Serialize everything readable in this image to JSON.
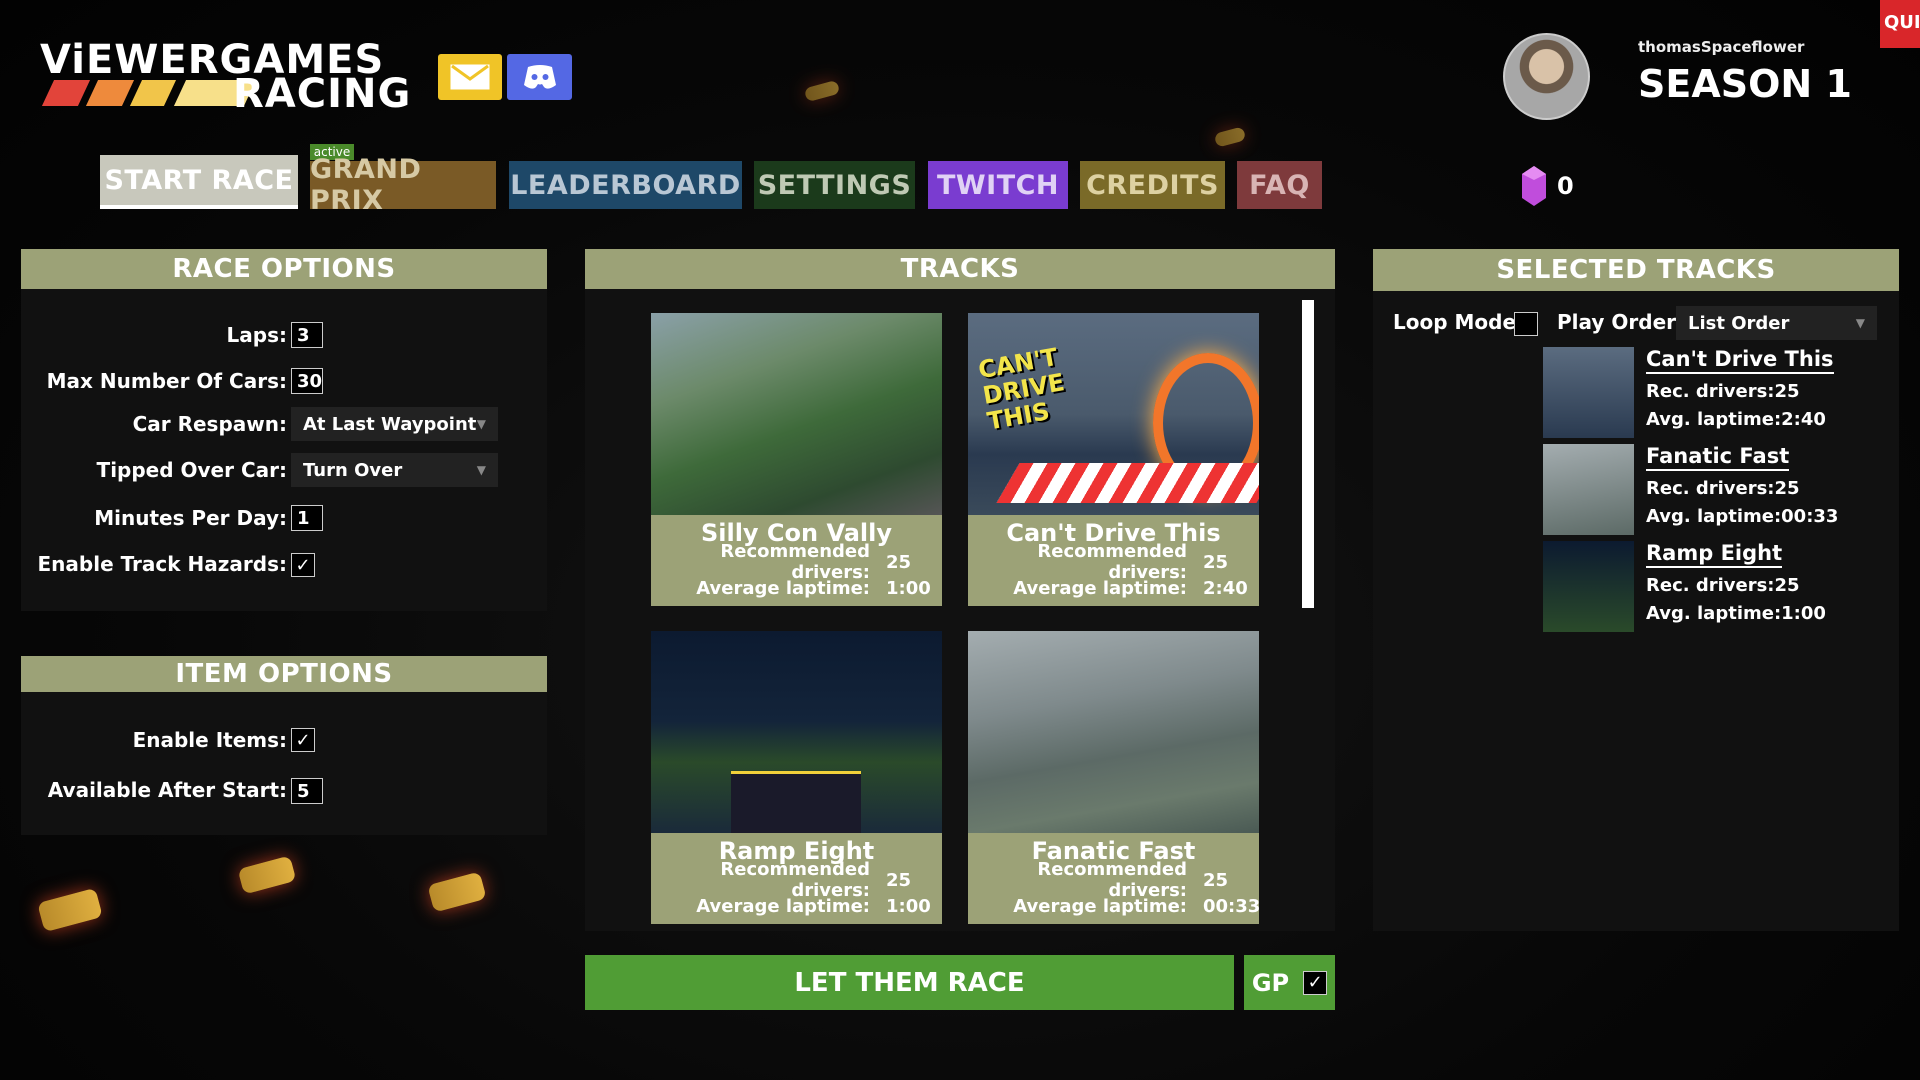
{
  "header": {
    "logo_line1": "ViEWERGAMES",
    "logo_line2": "RACING",
    "username": "thomasSpaceflower",
    "season": "SEASON 1",
    "quit_label": "QUIT",
    "gems_count": "0",
    "icons": [
      "mail-icon",
      "discord-icon",
      "gem-icon"
    ]
  },
  "tabs": [
    {
      "label": "START RACE",
      "color": "#c8c8bc"
    },
    {
      "label": "GRAND PRIX",
      "color": "#7a5a26",
      "badge": "active"
    },
    {
      "label": "LEADERBOARD",
      "color": "#1e4868"
    },
    {
      "label": "SETTINGS",
      "color": "#1b3a1b"
    },
    {
      "label": "TWITCH",
      "color": "#7a3cd0"
    },
    {
      "label": "CREDITS",
      "color": "#7a6a28"
    },
    {
      "label": "FAQ",
      "color": "#7e3a3c"
    }
  ],
  "race_options": {
    "title": "RACE OPTIONS",
    "laps_label": "Laps:",
    "laps_value": "3",
    "max_cars_label": "Max Number Of Cars:",
    "max_cars_value": "30",
    "respawn_label": "Car Respawn:",
    "respawn_value": "At Last Waypoint",
    "tipped_label": "Tipped Over Car:",
    "tipped_value": "Turn Over",
    "minutes_label": "Minutes Per Day:",
    "minutes_value": "1",
    "hazards_label": "Enable Track Hazards:",
    "hazards_checked": true
  },
  "item_options": {
    "title": "ITEM OPTIONS",
    "enable_label": "Enable Items:",
    "enable_checked": true,
    "after_start_label": "Available After Start:",
    "after_start_value": "5"
  },
  "tracks": {
    "title": "TRACKS",
    "rec_label": "Recommended drivers:",
    "avg_label": "Average laptime:",
    "items": [
      {
        "name": "Silly Con Vally",
        "drivers": "25",
        "laptime": "1:00"
      },
      {
        "name": "Can't Drive This",
        "drivers": "25",
        "laptime": "2:40",
        "logo_text": "CAN'T DRIVE THIS"
      },
      {
        "name": "Ramp Eight",
        "drivers": "25",
        "laptime": "1:00"
      },
      {
        "name": "Fanatic Fast",
        "drivers": "25",
        "laptime": "00:33"
      }
    ]
  },
  "selected_tracks": {
    "title": "SELECTED TRACKS",
    "loop_label": "Loop Mode:",
    "loop_checked": false,
    "order_label": "Play Order:",
    "order_value": "List Order",
    "items": [
      {
        "name": "Can't Drive This",
        "drivers": "Rec. drivers:25",
        "laptime": "Avg. laptime:2:40"
      },
      {
        "name": "Fanatic Fast",
        "drivers": "Rec. drivers:25",
        "laptime": "Avg. laptime:00:33"
      },
      {
        "name": "Ramp Eight",
        "drivers": "Rec. drivers:25",
        "laptime": "Avg. laptime:1:00"
      }
    ]
  },
  "actions": {
    "race_button": "LET THEM RACE",
    "gp_label": "GP",
    "gp_checked": true
  }
}
